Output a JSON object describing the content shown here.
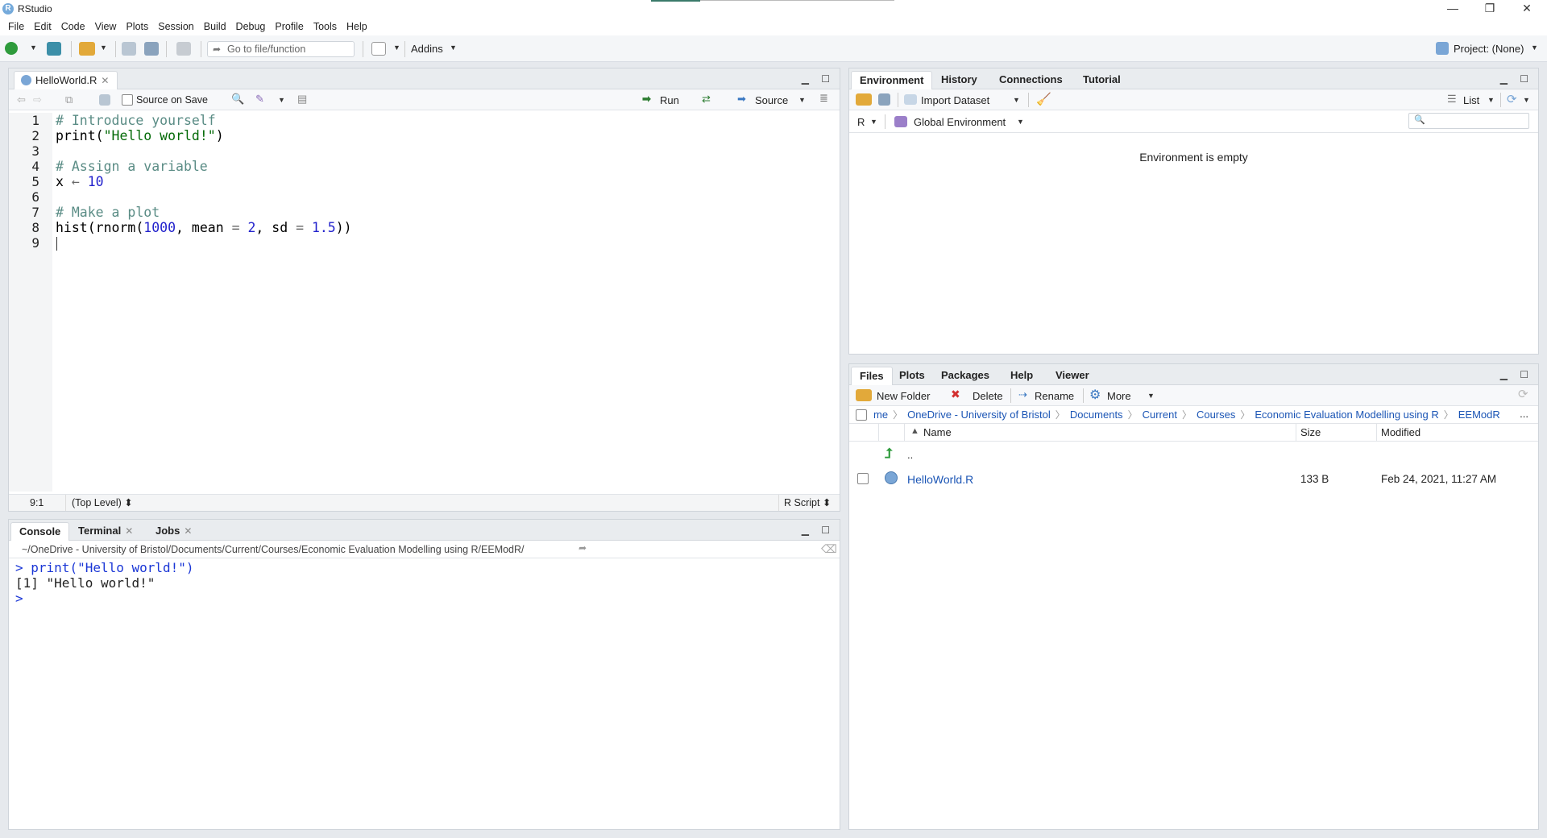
{
  "window": {
    "title": "RStudio",
    "logo_letter": "R",
    "minimize": "—",
    "maximize": "❐",
    "close": "✕"
  },
  "menu": [
    "File",
    "Edit",
    "Code",
    "View",
    "Plots",
    "Session",
    "Build",
    "Debug",
    "Profile",
    "Tools",
    "Help"
  ],
  "toolbar": {
    "goto_placeholder": "Go to file/function",
    "addins": "Addins",
    "project": "Project: (None)"
  },
  "editor": {
    "tab": "HelloWorld.R",
    "source_on_save": "Source on Save",
    "run": "Run",
    "source": "Source",
    "line_numbers": [
      "1",
      "2",
      "3",
      "4",
      "5",
      "6",
      "7",
      "8",
      "9"
    ],
    "code": {
      "l1": "# Introduce yourself",
      "l2a": "print(",
      "l2b": "\"Hello world!\"",
      "l2c": ")",
      "l4": "# Assign a variable",
      "l5a": "x ",
      "l5b": "←",
      "l5c": " 10",
      "l7": "# Make a plot",
      "l8a": "hist(rnorm(",
      "l8b": "1000",
      "l8c": ", mean ",
      "l8d": "=",
      "l8e": " ",
      "l8f": "2",
      "l8g": ", sd ",
      "l8h": "=",
      "l8i": " ",
      "l8j": "1.5",
      "l8k": "))"
    },
    "status_pos": "9:1",
    "status_scope": "(Top Level) ⬍",
    "status_type": "R Script ⬍"
  },
  "console": {
    "tabs": [
      "Console",
      "Terminal",
      "Jobs"
    ],
    "path": "~/OneDrive - University of Bristol/Documents/Current/Courses/Economic Evaluation Modelling using R/EEModR/",
    "line1_prompt": ">",
    "line1_cmd": " print(\"Hello world!\")",
    "line2": "[1] \"Hello world!\"",
    "line3_prompt": ">"
  },
  "environment": {
    "tabs": [
      "Environment",
      "History",
      "Connections",
      "Tutorial"
    ],
    "import_dataset": "Import Dataset",
    "list_view": "List",
    "lang": "R",
    "scope": "Global Environment",
    "empty_message": "Environment is empty"
  },
  "files": {
    "tabs": [
      "Files",
      "Plots",
      "Packages",
      "Help",
      "Viewer"
    ],
    "new_folder": "New Folder",
    "delete": "Delete",
    "rename": "Rename",
    "more": "More",
    "breadcrumb": [
      "me",
      "OneDrive - University of Bristol",
      "Documents",
      "Current",
      "Courses",
      "Economic Evaluation Modelling using R",
      "EEModR"
    ],
    "overflow": "...",
    "columns": {
      "name": "Name",
      "size": "Size",
      "modified": "Modified",
      "sort_indicator": "▲"
    },
    "up_dir": "..",
    "rows": [
      {
        "name": "HelloWorld.R",
        "size": "133 B",
        "modified": "Feb 24, 2021, 11:27 AM"
      }
    ]
  },
  "colors": {
    "accent_blue": "#1b55b5",
    "comment": "#5a8c85",
    "string": "#036a07",
    "number": "#2222cc",
    "prompt": "#1a36d6"
  }
}
